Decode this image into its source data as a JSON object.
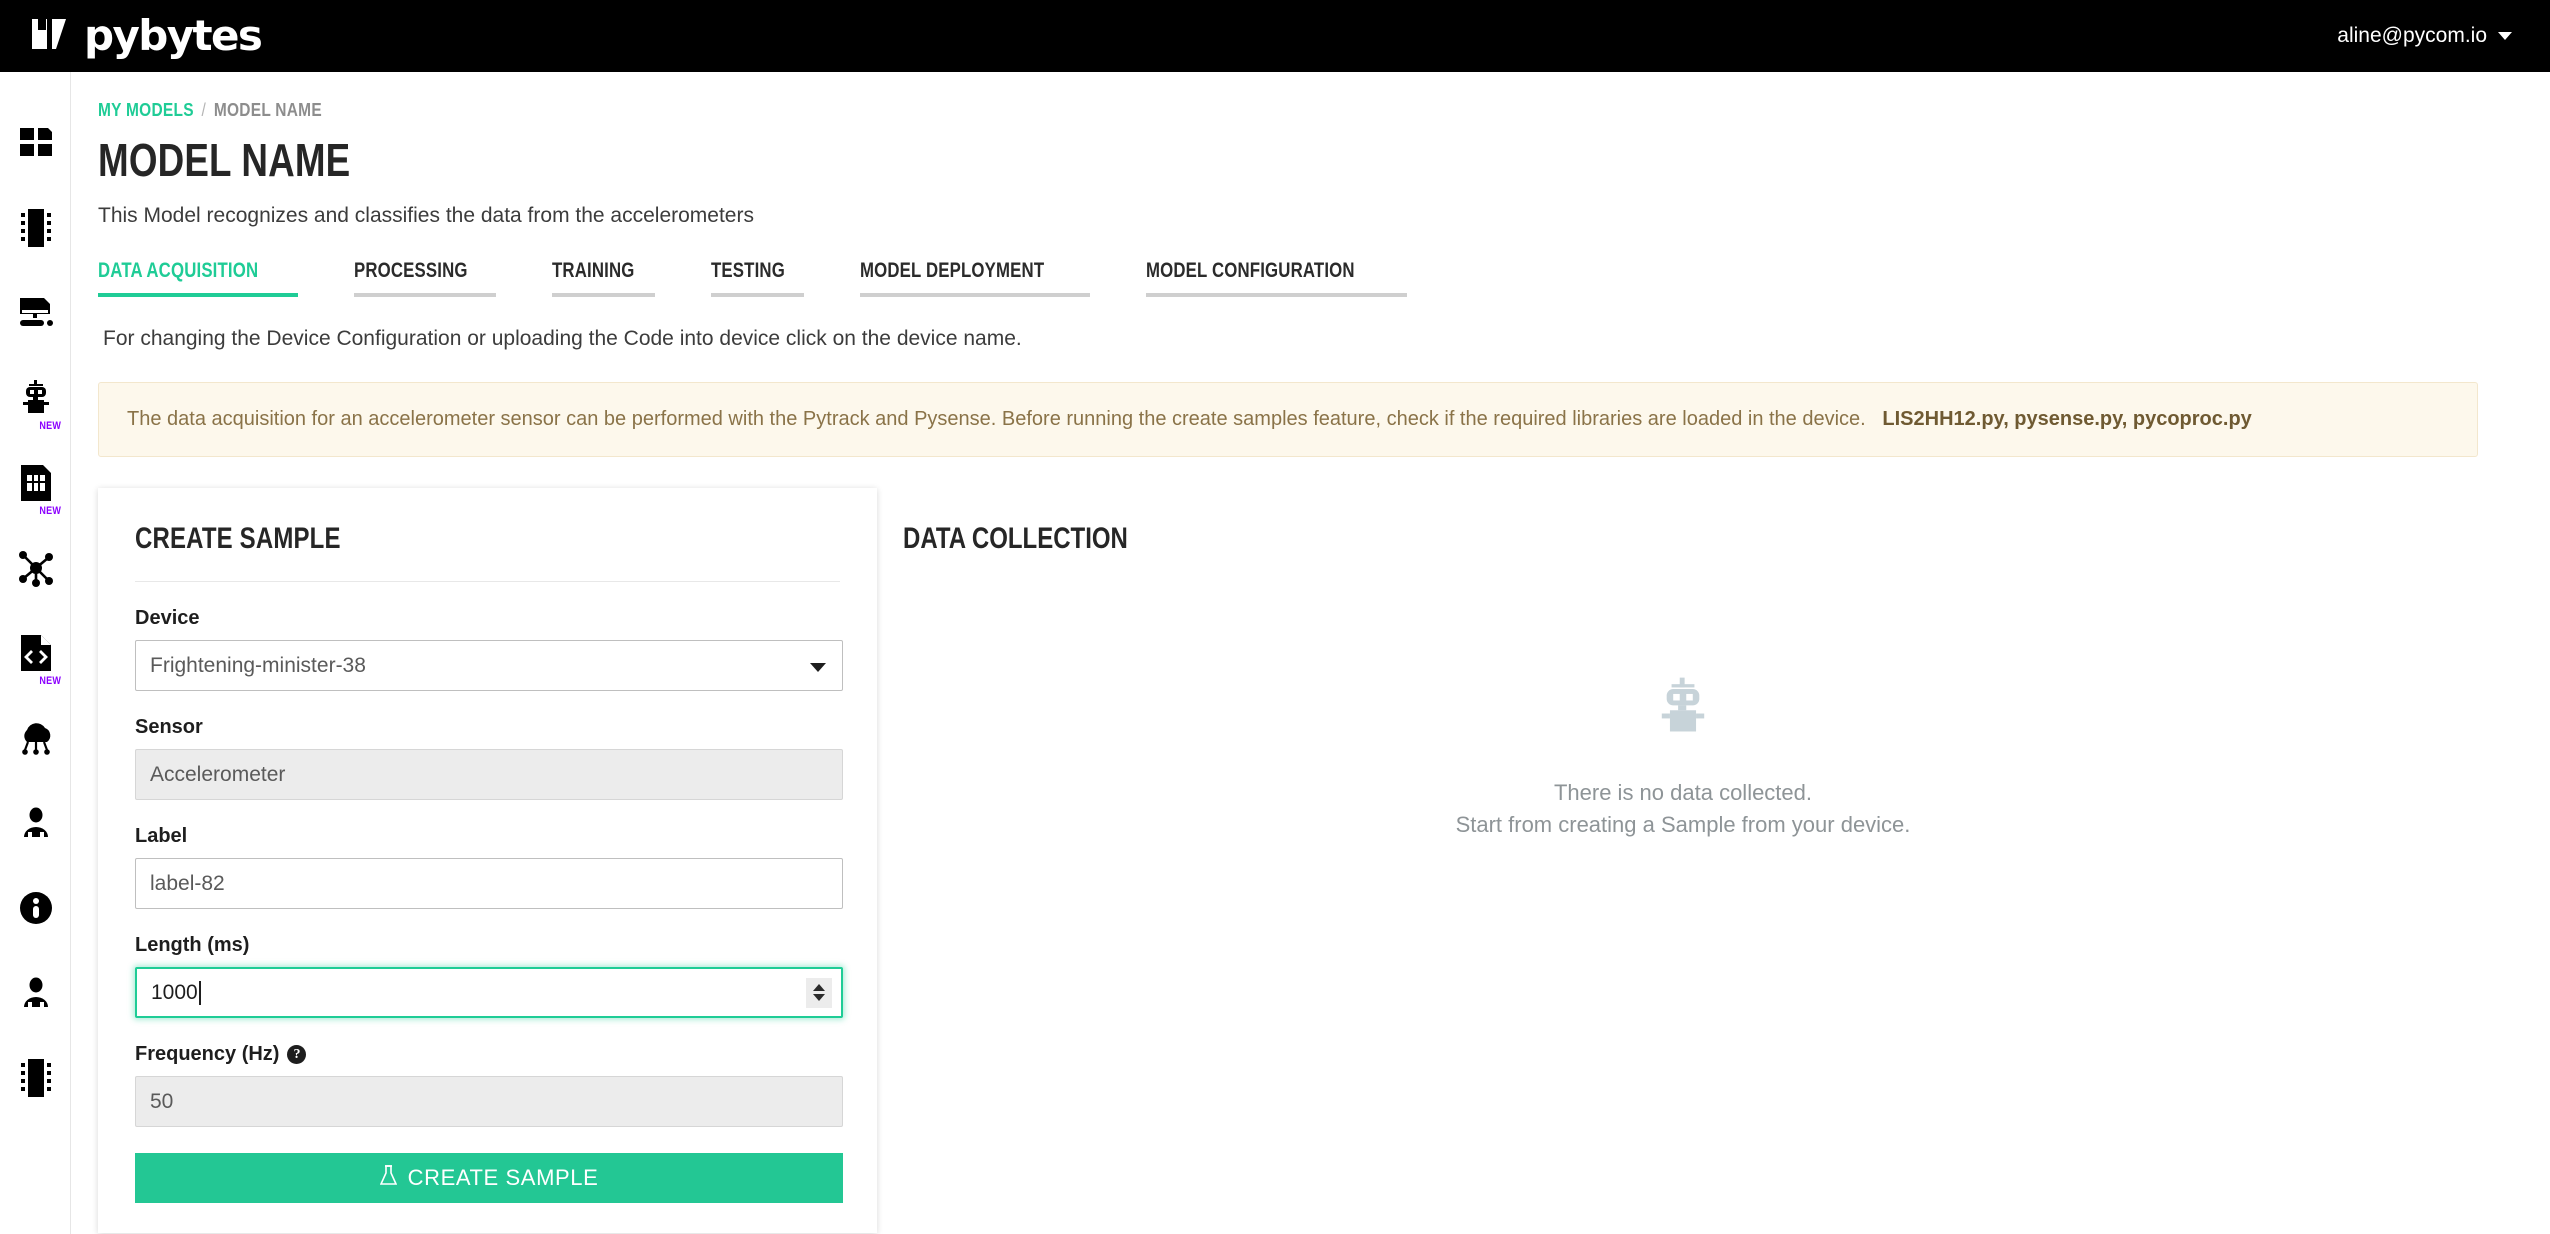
{
  "topbar": {
    "brand": "pybytes",
    "brand_icon": "pybytes-logo-icon",
    "user_email": "aline@pycom.io",
    "user_caret_icon": "chevron-down-icon"
  },
  "sidebar": {
    "items": [
      {
        "icon": "dashboard-grid-icon",
        "name": "dashboard",
        "badge": ""
      },
      {
        "icon": "chip-module-icon",
        "name": "devices",
        "badge": ""
      },
      {
        "icon": "monitor-terminal-icon",
        "name": "terminal",
        "badge": ""
      },
      {
        "icon": "robot-icon",
        "name": "machine-learning",
        "badge": "NEW"
      },
      {
        "icon": "sim-card-icon",
        "name": "sim-cards",
        "badge": "NEW"
      },
      {
        "icon": "network-nodes-icon",
        "name": "networks",
        "badge": ""
      },
      {
        "icon": "code-file-icon",
        "name": "firmware-code",
        "badge": "NEW"
      },
      {
        "icon": "cloud-iot-icon",
        "name": "integrations",
        "badge": ""
      },
      {
        "icon": "user-icon",
        "name": "account",
        "badge": ""
      },
      {
        "icon": "info-circle-icon",
        "name": "help",
        "badge": ""
      },
      {
        "icon": "user-icon",
        "name": "profile",
        "badge": ""
      },
      {
        "icon": "chip-module-icon",
        "name": "hardware",
        "badge": ""
      }
    ]
  },
  "breadcrumb": {
    "root": "MY MODELS",
    "separator": "/",
    "current": "MODEL NAME"
  },
  "page": {
    "title": "MODEL NAME",
    "subtitle": "This Model recognizes and classifies the data from the accelerometers",
    "device_hint": "For changing the Device Configuration or uploading the Code into device click on the device name."
  },
  "tabs": [
    {
      "label": "DATA ACQUISITION",
      "active": true
    },
    {
      "label": "PROCESSING",
      "active": false
    },
    {
      "label": "TRAINING",
      "active": false
    },
    {
      "label": "TESTING",
      "active": false
    },
    {
      "label": "MODEL DEPLOYMENT",
      "active": false
    },
    {
      "label": "MODEL CONFIGURATION",
      "active": false
    }
  ],
  "notice": {
    "text": "The data acquisition for an accelerometer sensor can be performed with the Pytrack and Pysense. Before running the create samples feature, check if the required libraries are loaded in the device.",
    "libraries": "LIS2HH12.py, pysense.py, pycoproc.py",
    "background_color": "#fdf8ec",
    "text_color": "#8a7348"
  },
  "create_sample": {
    "title": "CREATE SAMPLE",
    "device": {
      "label": "Device",
      "value": "Frightening-minister-38",
      "arrow_icon": "caret-down-icon"
    },
    "sensor": {
      "label": "Sensor",
      "value": "Accelerometer",
      "readonly": true
    },
    "sample_label": {
      "label": "Label",
      "value": "label-82",
      "placeholder": "label-82"
    },
    "length": {
      "label": "Length (ms)",
      "value": "1000",
      "focused": true,
      "spinner_icon": "number-spinner-icon"
    },
    "frequency": {
      "label": "Frequency (Hz)",
      "value": "50",
      "readonly": true,
      "help_icon": "question-mark-icon",
      "help_glyph": "?"
    },
    "submit": {
      "label": "CREATE SAMPLE",
      "icon": "flask-icon",
      "color": "#23c794"
    }
  },
  "data_collection": {
    "title": "DATA COLLECTION",
    "empty_icon": "robot-icon",
    "empty_line1": "There is no data collected.",
    "empty_line2": "Start from creating a Sample from your device.",
    "empty_icon_color": "#c7d3d9"
  },
  "theme": {
    "accent": "#1fcc96",
    "topbar_bg": "#000000",
    "badge_new": "#8b00ff"
  }
}
